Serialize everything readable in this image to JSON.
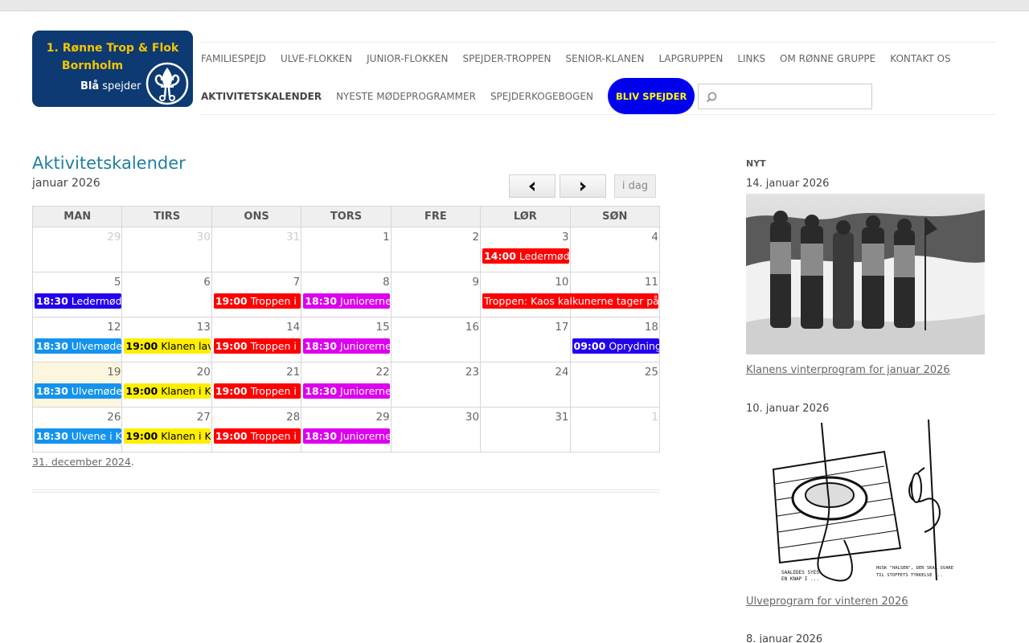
{
  "logo": {
    "line1": "1. Rønne Trop & Flok",
    "line2": "Bornholm",
    "line3a": "Blå",
    "line3b": "spejder",
    "brand_color": "#0d3a72",
    "accent_color": "#f5c400"
  },
  "nav": {
    "row1": [
      "Familiespejd",
      "Ulve-flokken",
      "Junior-flokken",
      "Spejder-troppen",
      "Senior-klanen",
      "Lapgruppen",
      "Links",
      "Om Rønne Gruppe",
      "Kontakt os"
    ],
    "row2": [
      "Aktivitetskalender",
      "Nyeste mødeprogrammer",
      "Spejderkogebogen"
    ],
    "active": "Aktivitetskalender",
    "cta": "BLIV SPEJDER",
    "cta_color": "#0000f0",
    "search_placeholder": ""
  },
  "calendar": {
    "title": "Aktivitetskalender",
    "month": "januar 2026",
    "prev_icon": "chevron-left-icon",
    "next_icon": "chevron-right-icon",
    "today_label": "i dag",
    "weekdays": [
      "Man",
      "Tirs",
      "Ons",
      "Tors",
      "Fre",
      "Lør",
      "Søn"
    ],
    "weeks": [
      [
        {
          "day": "29",
          "other": true
        },
        {
          "day": "30",
          "other": true
        },
        {
          "day": "31",
          "other": true
        },
        {
          "day": "1"
        },
        {
          "day": "2"
        },
        {
          "day": "3",
          "events": [
            {
              "time": "14:00",
              "title": "Ledermøde",
              "bg": "#ff0000",
              "fg": "#ffffff"
            }
          ]
        },
        {
          "day": "4"
        }
      ],
      [
        {
          "day": "5",
          "events": [
            {
              "time": "18:30",
              "title": "Ledermøde",
              "bg": "#2200ee",
              "fg": "#ffffff"
            }
          ]
        },
        {
          "day": "6"
        },
        {
          "day": "7",
          "events": [
            {
              "time": "19:00",
              "title": "Troppen i K",
              "bg": "#ff0000",
              "fg": "#ffffff"
            }
          ]
        },
        {
          "day": "8",
          "events": [
            {
              "time": "18:30",
              "title": "Juniorerne i",
              "bg": "#dd00ee",
              "fg": "#ffffff"
            }
          ]
        },
        {
          "day": "9"
        },
        {
          "day": "10",
          "events": [
            {
              "time": "",
              "title": "Troppen: Kaos kalkunerne tager på h",
              "bg": "#ff0000",
              "fg": "#ffffff",
              "span": 2
            }
          ]
        },
        {
          "day": "11"
        }
      ],
      [
        {
          "day": "12",
          "events": [
            {
              "time": "18:30",
              "title": "Ulvemøde i",
              "bg": "#1493ee",
              "fg": "#ffffff"
            }
          ]
        },
        {
          "day": "13",
          "events": [
            {
              "time": "19:00",
              "title": "Klanen lave",
              "bg": "#ffee00",
              "fg": "#000000"
            }
          ]
        },
        {
          "day": "14",
          "events": [
            {
              "time": "19:00",
              "title": "Troppen i K",
              "bg": "#ff0000",
              "fg": "#ffffff"
            }
          ]
        },
        {
          "day": "15",
          "events": [
            {
              "time": "18:30",
              "title": "Juniorerne i",
              "bg": "#dd00ee",
              "fg": "#ffffff"
            }
          ]
        },
        {
          "day": "16"
        },
        {
          "day": "17"
        },
        {
          "day": "18",
          "events": [
            {
              "time": "09:00",
              "title": "Oprydning",
              "bg": "#2200ee",
              "fg": "#ffffff"
            }
          ]
        }
      ],
      [
        {
          "day": "19",
          "today": true,
          "events": [
            {
              "time": "18:30",
              "title": "Ulvemøde i",
              "bg": "#1493ee",
              "fg": "#ffffff"
            }
          ]
        },
        {
          "day": "20",
          "events": [
            {
              "time": "19:00",
              "title": "Klanen i Kar",
              "bg": "#ffee00",
              "fg": "#000000"
            }
          ]
        },
        {
          "day": "21",
          "events": [
            {
              "time": "19:00",
              "title": "Troppen i K",
              "bg": "#ff0000",
              "fg": "#ffffff"
            }
          ]
        },
        {
          "day": "22",
          "events": [
            {
              "time": "18:30",
              "title": "Juniorerne i",
              "bg": "#dd00ee",
              "fg": "#ffffff"
            }
          ]
        },
        {
          "day": "23"
        },
        {
          "day": "24"
        },
        {
          "day": "25"
        }
      ],
      [
        {
          "day": "26",
          "events": [
            {
              "time": "18:30",
              "title": "Ulvene i Kar",
              "bg": "#1493ee",
              "fg": "#ffffff"
            }
          ]
        },
        {
          "day": "27",
          "events": [
            {
              "time": "19:00",
              "title": "Klanen i Kar",
              "bg": "#ffee00",
              "fg": "#000000"
            }
          ]
        },
        {
          "day": "28",
          "events": [
            {
              "time": "19:00",
              "title": "Troppen i K",
              "bg": "#ff0000",
              "fg": "#ffffff"
            }
          ]
        },
        {
          "day": "29",
          "events": [
            {
              "time": "18:30",
              "title": "Juniorerne i",
              "bg": "#dd00ee",
              "fg": "#ffffff"
            }
          ]
        },
        {
          "day": "30"
        },
        {
          "day": "31"
        },
        {
          "day": "1",
          "other": true
        }
      ]
    ],
    "prev_link": "31. december 2024",
    "prev_link_suffix": "."
  },
  "sidebar": {
    "heading": "Nyt",
    "posts": [
      {
        "date": "14. januar 2026",
        "link": "Klanens vinterprogram for januar 2026"
      },
      {
        "date": "10. januar 2026",
        "link": "Ulveprogram for vinteren 2026"
      },
      {
        "date": "8. januar 2026"
      }
    ],
    "sketch_caption_left_1": "SAALEDES SYES",
    "sketch_caption_left_2": "EN KNAP I ...",
    "sketch_caption_right_1": "HUSK \"HALSEN\", DER SKAL SVARE",
    "sketch_caption_right_2": "TIL STOFFETS TYKKELSE ..."
  }
}
